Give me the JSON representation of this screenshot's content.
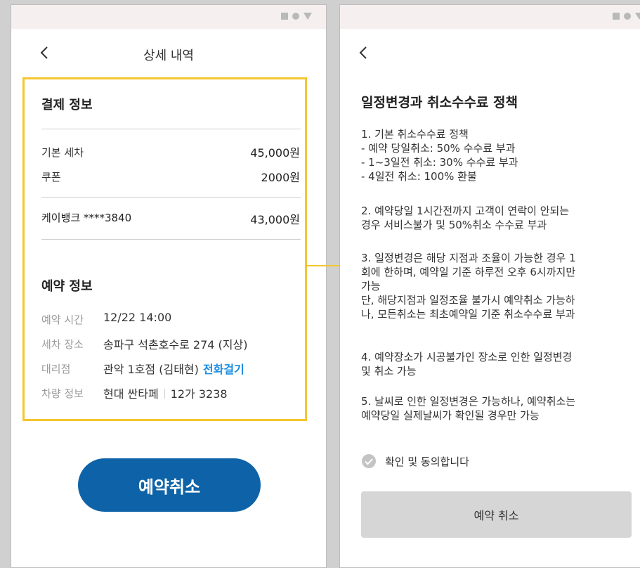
{
  "left_screen": {
    "title": "상세 내역",
    "payment": {
      "heading": "결제 정보",
      "items": [
        {
          "label": "기본 세차",
          "value": "45,000원"
        },
        {
          "label": "쿠폰",
          "value": "2000원"
        }
      ],
      "method": {
        "label": "케이뱅크 ****3840",
        "value": "43,000원"
      }
    },
    "reservation": {
      "heading": "예약 정보",
      "time": {
        "label": "예약 시간",
        "value": "12/22 14:00"
      },
      "place": {
        "label": "세차 장소",
        "value": "송파구 석촌호수로 274 (지상)"
      },
      "agency": {
        "label": "대리점",
        "value": "관악 1호점 (김태현)",
        "call": "전화걸기"
      },
      "car": {
        "label": "차량 정보",
        "model": "현대 싼타페",
        "plate": "12가 3238"
      }
    },
    "cancel_button": "예약취소"
  },
  "right_screen": {
    "heading": "일정변경과 취소수수료 정책",
    "policy": [
      {
        "lines": [
          "1. 기본 취소수수료 정책",
          "- 예약 당일취소: 50% 수수료 부과",
          "- 1~3일전 취소: 30% 수수료 부과",
          "- 4일전 취소: 100% 환불"
        ]
      },
      {
        "lines": [
          "2. 예약당일 1시간전까지 고객이 연락이 안되는",
          "경우 서비스불가 및 50%취소 수수료 부과"
        ]
      },
      {
        "lines": [
          "3. 일정변경은 해당 지점과 조율이 가능한 경우 1",
          "회에 한하며, 예약일 기준 하루전 오후 6시까지만",
          "가능",
          "단, 해당지점과 일정조율 불가시 예약취소 가능하",
          "나, 모든취소는 최초예약일 기준 취소수수료 부과"
        ]
      },
      {
        "lines": [
          "4. 예약장소가 시공불가인 장소로 인한 일정변경",
          "및 취소 가능"
        ]
      },
      {
        "lines": [
          "5. 날씨로 인한 일정변경은 가능하나, 예약취소는",
          "예약당일 실제날씨가 확인될 경우만 가능"
        ]
      }
    ],
    "agree_label": "확인 및 동의합니다",
    "cancel_button": "예약 취소"
  },
  "colors": {
    "highlight": "#f5c62e",
    "primary_button": "#0e63a8",
    "link": "#1a8ce0",
    "disabled_button": "#d6d6d6"
  }
}
